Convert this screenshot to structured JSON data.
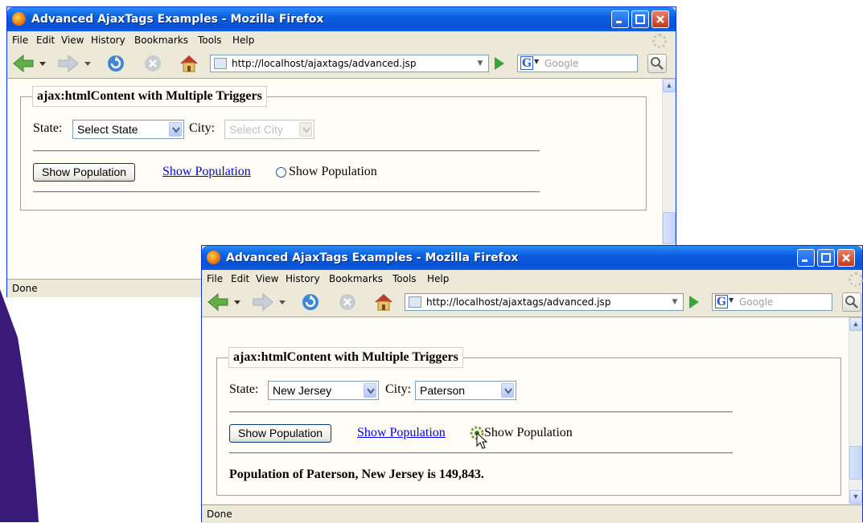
{
  "colors": {
    "accent_purple": "#3a1a78",
    "titlebar_blue": "#0852d4",
    "link_blue": "#0000ee"
  },
  "window_back": {
    "title": "Advanced AjaxTags Examples - Mozilla Firefox",
    "menu": [
      "File",
      "Edit",
      "View",
      "History",
      "Bookmarks",
      "Tools",
      "Help"
    ],
    "url": "http://localhost/ajaxtags/advanced.jsp",
    "search_placeholder": "Google",
    "legend": "ajax:htmlContent with Multiple Triggers",
    "state_label": "State:",
    "state_value": "Select State",
    "city_label": "City:",
    "city_value": "Select City",
    "button_label": "Show Population",
    "link_label": "Show Population",
    "radio_label": "Show Population",
    "status": "Done"
  },
  "window_front": {
    "title": "Advanced AjaxTags Examples - Mozilla Firefox",
    "menu": [
      "File",
      "Edit",
      "View",
      "History",
      "Bookmarks",
      "Tools",
      "Help"
    ],
    "url": "http://localhost/ajaxtags/advanced.jsp",
    "search_placeholder": "Google",
    "legend": "ajax:htmlContent with Multiple Triggers",
    "state_label": "State:",
    "state_value": "New Jersey",
    "city_label": "City:",
    "city_value": "Paterson",
    "button_label": "Show Population",
    "link_label": "Show Population",
    "radio_label": "Show Population",
    "result": "Population of Paterson, New Jersey is 149,843.",
    "status": "Done"
  }
}
